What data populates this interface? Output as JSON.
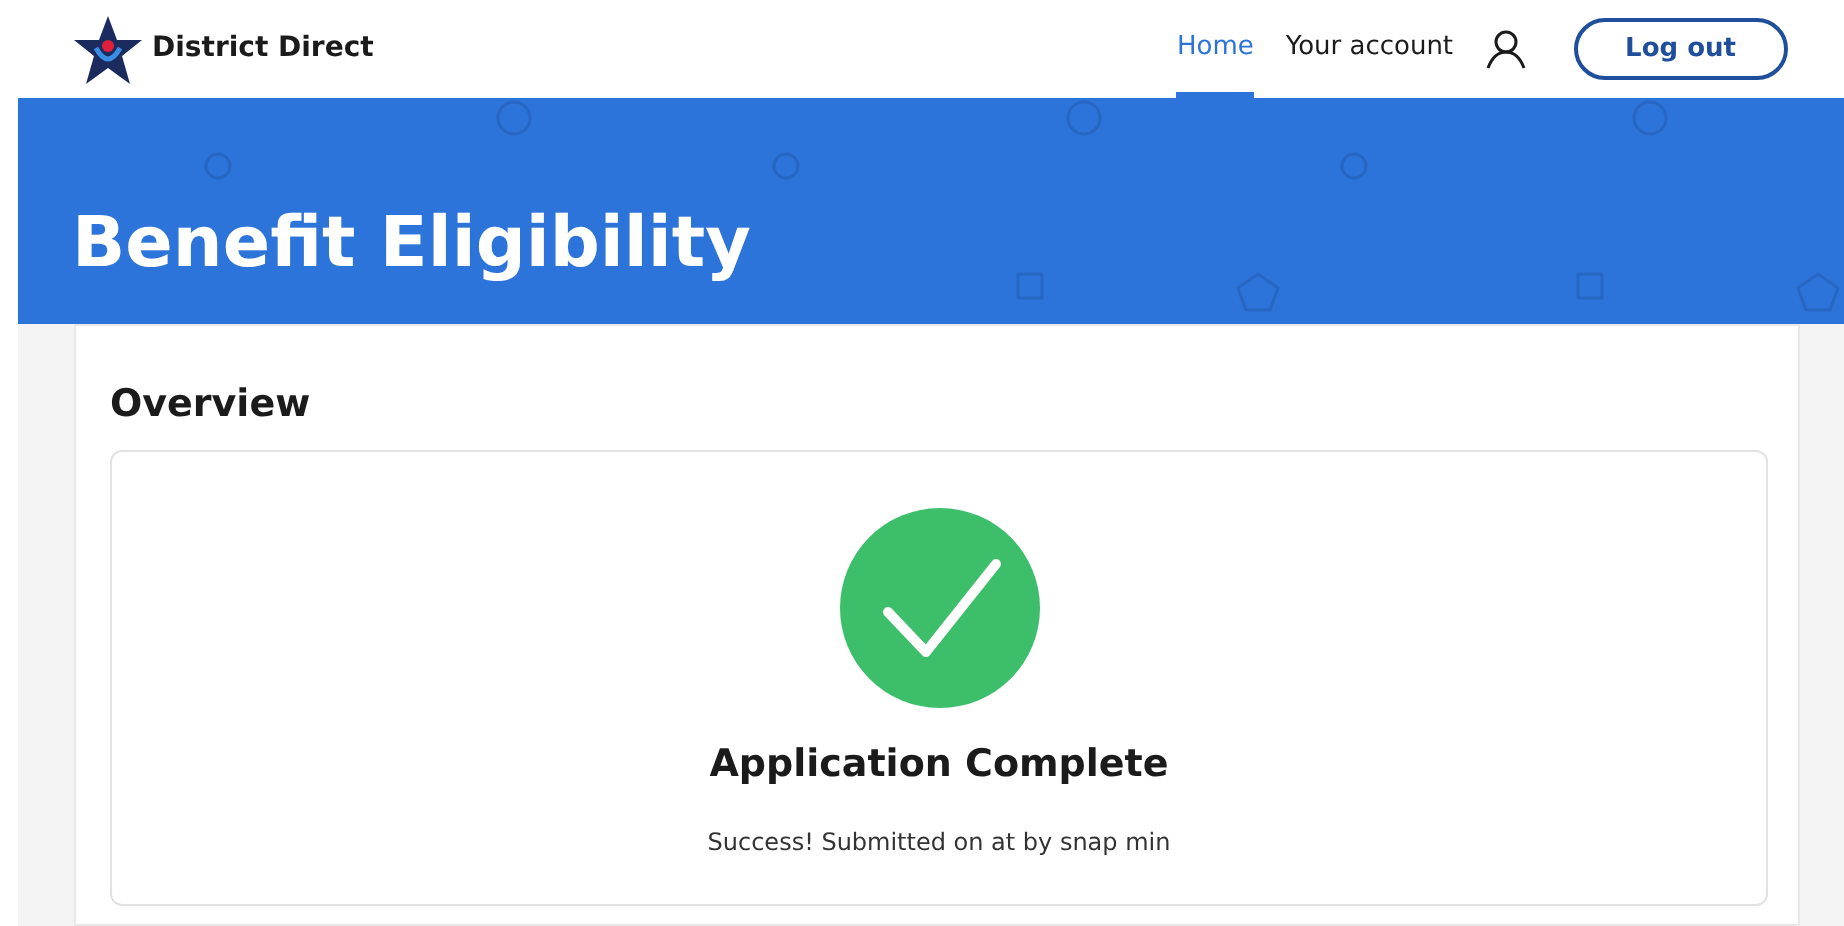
{
  "header": {
    "brand": "District Direct",
    "nav": [
      {
        "label": "Home",
        "selected": true
      },
      {
        "label": "Your account",
        "selected": false
      }
    ],
    "logout": "Log out"
  },
  "banner": {
    "title": "Benefit Eligibility"
  },
  "overview": {
    "heading": "Overview",
    "status_title": "Application Complete",
    "status_text": "Success! Submitted on at by snap min"
  }
}
